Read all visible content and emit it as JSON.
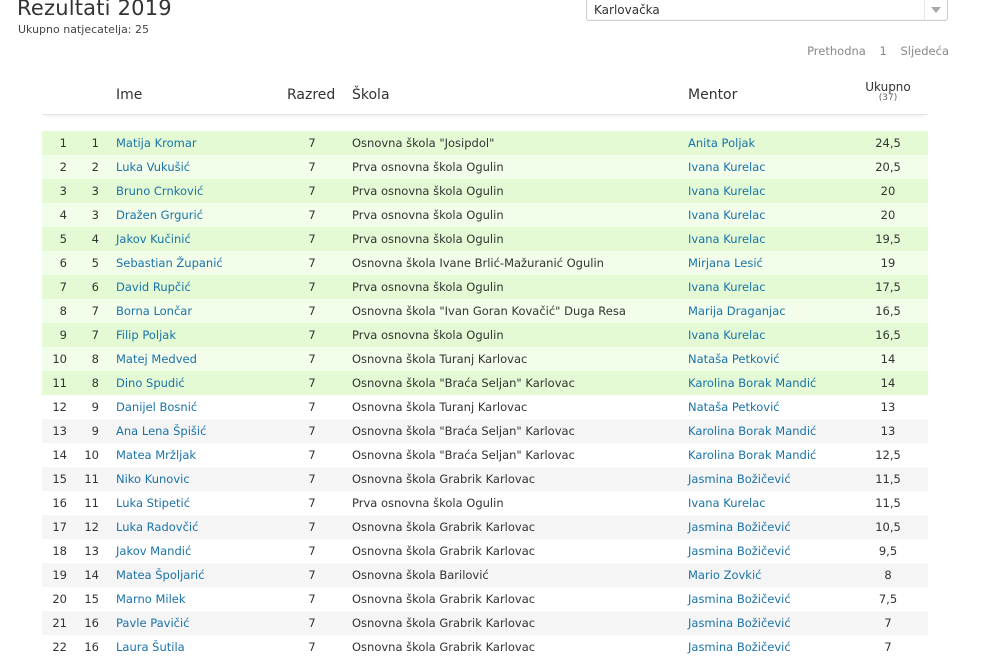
{
  "page": {
    "title": "Rezultati 2019",
    "subtitle": "Ukupno natjecatelja: 25"
  },
  "county_select": {
    "value": "Karlovačka"
  },
  "pagination": {
    "prev": "Prethodna",
    "current": "1",
    "next": "Sljedeća"
  },
  "table": {
    "headers": {
      "ime": "Ime",
      "razred": "Razred",
      "skola": "Škola",
      "mentor": "Mentor",
      "ukupno": "Ukupno",
      "max": "(37)"
    },
    "rows": [
      {
        "pos": "1",
        "rank": "1",
        "ime": "Matija Kromar",
        "razred": "7",
        "skola": "Osnovna škola \"Josipdol\"",
        "mentor": "Anita Poljak",
        "ukupno": "24,5",
        "qualified": true
      },
      {
        "pos": "2",
        "rank": "2",
        "ime": "Luka Vukušić",
        "razred": "7",
        "skola": "Prva osnovna škola Ogulin",
        "mentor": "Ivana Kurelac",
        "ukupno": "20,5",
        "qualified": true
      },
      {
        "pos": "3",
        "rank": "3",
        "ime": "Bruno Crnković",
        "razred": "7",
        "skola": "Prva osnovna škola Ogulin",
        "mentor": "Ivana Kurelac",
        "ukupno": "20",
        "qualified": true
      },
      {
        "pos": "4",
        "rank": "3",
        "ime": "Dražen Grgurić",
        "razred": "7",
        "skola": "Prva osnovna škola Ogulin",
        "mentor": "Ivana Kurelac",
        "ukupno": "20",
        "qualified": true
      },
      {
        "pos": "5",
        "rank": "4",
        "ime": "Jakov Kučinić",
        "razred": "7",
        "skola": "Prva osnovna škola Ogulin",
        "mentor": "Ivana Kurelac",
        "ukupno": "19,5",
        "qualified": true
      },
      {
        "pos": "6",
        "rank": "5",
        "ime": "Sebastian Županić",
        "razred": "7",
        "skola": "Osnovna škola Ivane Brlić-Mažuranić Ogulin",
        "mentor": "Mirjana Lesić",
        "ukupno": "19",
        "qualified": true
      },
      {
        "pos": "7",
        "rank": "6",
        "ime": "David Rupčić",
        "razred": "7",
        "skola": "Prva osnovna škola Ogulin",
        "mentor": "Ivana Kurelac",
        "ukupno": "17,5",
        "qualified": true
      },
      {
        "pos": "8",
        "rank": "7",
        "ime": "Borna Lončar",
        "razred": "7",
        "skola": "Osnovna škola \"Ivan Goran Kovačić\" Duga Resa",
        "mentor": "Marija Draganjac",
        "ukupno": "16,5",
        "qualified": true
      },
      {
        "pos": "9",
        "rank": "7",
        "ime": "Filip Poljak",
        "razred": "7",
        "skola": "Prva osnovna škola Ogulin",
        "mentor": "Ivana Kurelac",
        "ukupno": "16,5",
        "qualified": true
      },
      {
        "pos": "10",
        "rank": "8",
        "ime": "Matej Medved",
        "razred": "7",
        "skola": "Osnovna škola Turanj Karlovac",
        "mentor": "Nataša Petković",
        "ukupno": "14",
        "qualified": true
      },
      {
        "pos": "11",
        "rank": "8",
        "ime": "Dino Spudić",
        "razred": "7",
        "skola": "Osnovna škola \"Braća Seljan\" Karlovac",
        "mentor": "Karolina Borak Mandić",
        "ukupno": "14",
        "qualified": true
      },
      {
        "pos": "12",
        "rank": "9",
        "ime": "Danijel Bosnić",
        "razred": "7",
        "skola": "Osnovna škola Turanj Karlovac",
        "mentor": "Nataša Petković",
        "ukupno": "13",
        "qualified": false
      },
      {
        "pos": "13",
        "rank": "9",
        "ime": "Ana Lena Špišić",
        "razred": "7",
        "skola": "Osnovna škola \"Braća Seljan\" Karlovac",
        "mentor": "Karolina Borak Mandić",
        "ukupno": "13",
        "qualified": false
      },
      {
        "pos": "14",
        "rank": "10",
        "ime": "Matea Mržljak",
        "razred": "7",
        "skola": "Osnovna škola \"Braća Seljan\" Karlovac",
        "mentor": "Karolina Borak Mandić",
        "ukupno": "12,5",
        "qualified": false
      },
      {
        "pos": "15",
        "rank": "11",
        "ime": "Niko Kunovic",
        "razred": "7",
        "skola": "Osnovna škola Grabrik Karlovac",
        "mentor": "Jasmina Božičević",
        "ukupno": "11,5",
        "qualified": false
      },
      {
        "pos": "16",
        "rank": "11",
        "ime": "Luka Stipetić",
        "razred": "7",
        "skola": "Prva osnovna škola Ogulin",
        "mentor": "Ivana Kurelac",
        "ukupno": "11,5",
        "qualified": false
      },
      {
        "pos": "17",
        "rank": "12",
        "ime": "Luka Radovčić",
        "razred": "7",
        "skola": "Osnovna škola Grabrik Karlovac",
        "mentor": "Jasmina Božičević",
        "ukupno": "10,5",
        "qualified": false
      },
      {
        "pos": "18",
        "rank": "13",
        "ime": "Jakov Mandić",
        "razred": "7",
        "skola": "Osnovna škola Grabrik Karlovac",
        "mentor": "Jasmina Božičević",
        "ukupno": "9,5",
        "qualified": false
      },
      {
        "pos": "19",
        "rank": "14",
        "ime": "Matea Špoljarić",
        "razred": "7",
        "skola": "Osnovna škola Barilović",
        "mentor": "Mario Zovkić",
        "ukupno": "8",
        "qualified": false
      },
      {
        "pos": "20",
        "rank": "15",
        "ime": "Marno Milek",
        "razred": "7",
        "skola": "Osnovna škola Grabrik Karlovac",
        "mentor": "Jasmina Božičević",
        "ukupno": "7,5",
        "qualified": false
      },
      {
        "pos": "21",
        "rank": "16",
        "ime": "Pavle Pavičić",
        "razred": "7",
        "skola": "Osnovna škola Grabrik Karlovac",
        "mentor": "Jasmina Božičević",
        "ukupno": "7",
        "qualified": false
      },
      {
        "pos": "22",
        "rank": "16",
        "ime": "Laura Šutila",
        "razred": "7",
        "skola": "Osnovna škola Grabrik Karlovac",
        "mentor": "Jasmina Božičević",
        "ukupno": "7",
        "qualified": false
      }
    ]
  },
  "colors": {
    "qualified_row_odd": "#e3fad4",
    "qualified_row_even": "#f2fdea",
    "link": "#1a73a8"
  }
}
